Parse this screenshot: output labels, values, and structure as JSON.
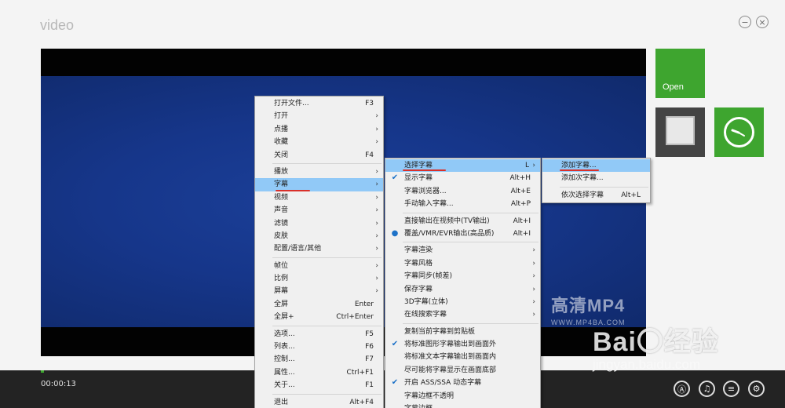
{
  "window": {
    "title": "video",
    "minimize_label": "−",
    "close_label": "×"
  },
  "tiles": {
    "open_label": "Open"
  },
  "player": {
    "time": "00:00:13"
  },
  "watermark": {
    "brand": "高清MP4",
    "url": "WWW.MP4BA.COM"
  },
  "baidu": {
    "logo": "Bai〇经验",
    "domain": "jingyan.baidu.com"
  },
  "controls": [
    "Ⓐ",
    "♫",
    "≡",
    "⚙"
  ],
  "main_menu": {
    "items": [
      {
        "label": "打开文件...",
        "shortcut": "F3"
      },
      {
        "label": "打开",
        "sub": true
      },
      {
        "label": "点播",
        "sub": true
      },
      {
        "label": "收藏",
        "sub": true
      },
      {
        "label": "关闭",
        "shortcut": "F4"
      },
      {
        "sep": true
      },
      {
        "label": "播放",
        "sub": true
      },
      {
        "label": "字幕",
        "sub": true,
        "highlight": true
      },
      {
        "label": "视频",
        "sub": true
      },
      {
        "label": "声音",
        "sub": true
      },
      {
        "label": "滤镜",
        "sub": true
      },
      {
        "label": "皮肤",
        "sub": true
      },
      {
        "label": "配置/语言/其他",
        "sub": true
      },
      {
        "sep": true
      },
      {
        "label": "帧位",
        "sub": true
      },
      {
        "label": "比例",
        "sub": true
      },
      {
        "label": "屏幕",
        "sub": true
      },
      {
        "label": "全屏",
        "shortcut": "Enter"
      },
      {
        "label": "全屏+",
        "shortcut": "Ctrl+Enter"
      },
      {
        "sep": true
      },
      {
        "label": "选项...",
        "shortcut": "F5"
      },
      {
        "label": "列表...",
        "shortcut": "F6"
      },
      {
        "label": "控制...",
        "shortcut": "F7"
      },
      {
        "label": "属性...",
        "shortcut": "Ctrl+F1"
      },
      {
        "label": "关于...",
        "shortcut": "F1"
      },
      {
        "sep": true
      },
      {
        "label": "退出",
        "shortcut": "Alt+F4"
      }
    ]
  },
  "subtitle_menu": {
    "items": [
      {
        "label": "选择字幕",
        "shortcut": "L",
        "sub": true,
        "highlight": true
      },
      {
        "label": "显示字幕",
        "shortcut": "Alt+H",
        "mark": "✔"
      },
      {
        "label": "字幕浏览器...",
        "shortcut": "Alt+E"
      },
      {
        "label": "手动输入字幕...",
        "shortcut": "Alt+P"
      },
      {
        "sep": true
      },
      {
        "label": "直接输出在视频中(TV输出)",
        "shortcut": "Alt+I"
      },
      {
        "label": "覆盖/VMR/EVR输出(高品质)",
        "shortcut": "Alt+I",
        "mark": "●"
      },
      {
        "sep": true
      },
      {
        "label": "字幕渲染",
        "sub": true
      },
      {
        "label": "字幕风格",
        "sub": true
      },
      {
        "label": "字幕同步(帧差)",
        "sub": true
      },
      {
        "label": "保存字幕",
        "sub": true
      },
      {
        "label": "3D字幕(立体)",
        "sub": true
      },
      {
        "label": "在线搜索字幕",
        "sub": true
      },
      {
        "sep": true
      },
      {
        "label": "复制当前字幕到剪贴板"
      },
      {
        "label": "将标准图形字幕输出到画面外",
        "mark": "✔"
      },
      {
        "label": "将标准文本字幕输出到画面内"
      },
      {
        "label": "尽可能将字幕显示在画面底部"
      },
      {
        "label": "开启 ASS/SSA 动态字幕",
        "mark": "✔"
      },
      {
        "label": "字幕边框不透明"
      },
      {
        "label": "字幕边框"
      }
    ]
  },
  "select_menu": {
    "items": [
      {
        "label": "添加字幕...",
        "highlight": true
      },
      {
        "label": "添加次字幕..."
      },
      {
        "sep": true
      },
      {
        "label": "依次选择字幕",
        "shortcut": "Alt+L"
      }
    ]
  }
}
